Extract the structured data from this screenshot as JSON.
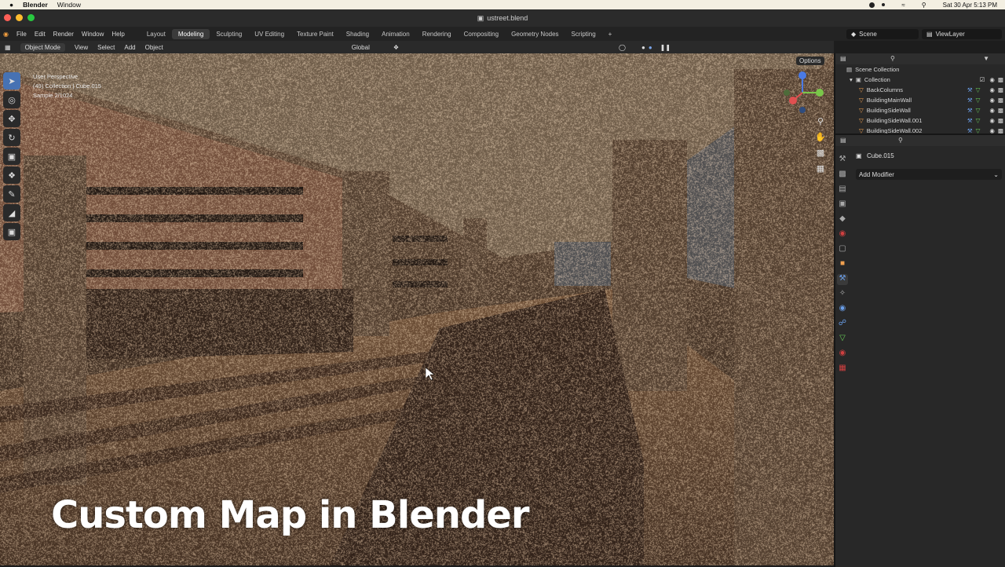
{
  "mac_menu": {
    "app": "Blender",
    "window": "Window",
    "datetime": "Sat 30 Apr  5:13 PM"
  },
  "title_bar": {
    "file": "ustreet.blend"
  },
  "menus": [
    "File",
    "Edit",
    "Render",
    "Window",
    "Help"
  ],
  "workspaces": [
    "Layout",
    "Modeling",
    "Sculpting",
    "UV Editing",
    "Texture Paint",
    "Shading",
    "Animation",
    "Rendering",
    "Compositing",
    "Geometry Nodes",
    "Scripting"
  ],
  "active_workspace": "Modeling",
  "scene": {
    "label": "Scene",
    "view_layer": "ViewLayer"
  },
  "viewport_header": {
    "mode": "Object Mode",
    "view": "View",
    "select": "Select",
    "add": "Add",
    "object": "Object",
    "transform": "Global",
    "options": "Options"
  },
  "viewport_info": {
    "line1": "User Perspective",
    "line2": "(49) Collection | Cube.015",
    "line3": "Sample 2/1024"
  },
  "caption": "Custom Map in Blender",
  "outliner": {
    "root": "Scene Collection",
    "collection": "Collection",
    "items": [
      "BackColumns",
      "BuildingMainWall",
      "BuildingSideWall",
      "BuildingSideWall.001",
      "BuildingSideWall.002"
    ]
  },
  "properties": {
    "object": "Cube.015",
    "add_modifier": "Add Modifier"
  },
  "colors": {
    "accent": "#4772b3",
    "header": "#2a2a2a",
    "panel": "#282828"
  }
}
